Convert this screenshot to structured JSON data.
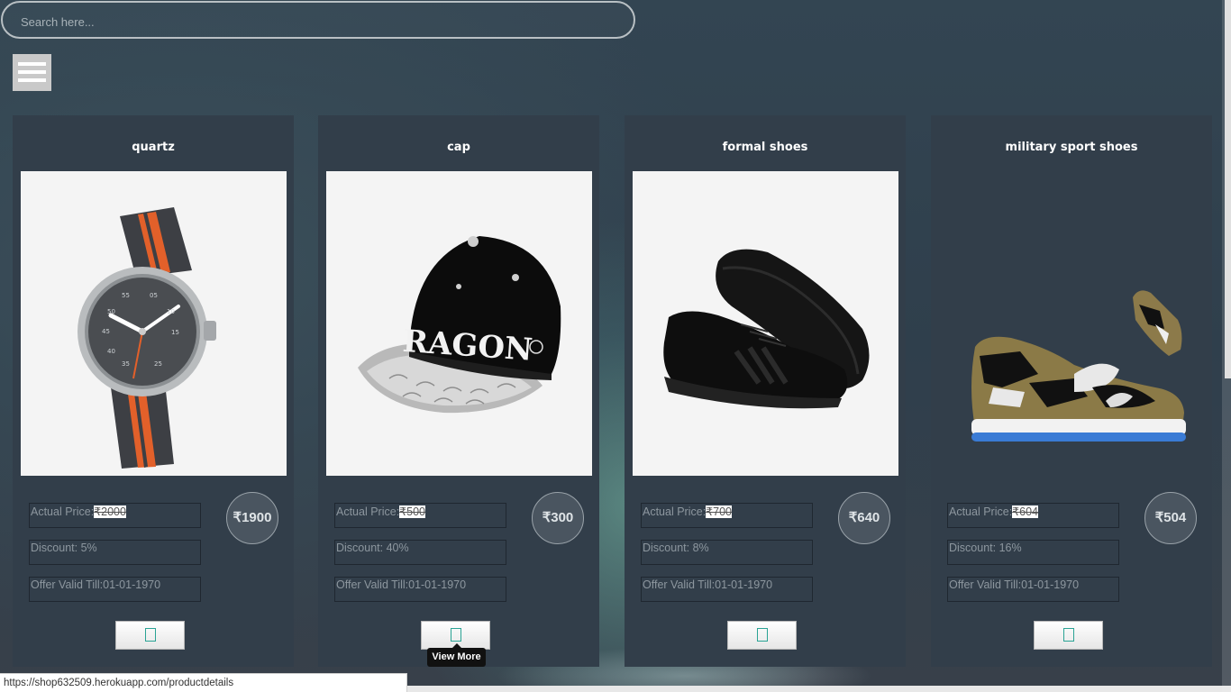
{
  "search": {
    "placeholder": "Search here...",
    "value": ""
  },
  "menu": {
    "icon": "hamburger-menu-icon"
  },
  "products": [
    {
      "title": "quartz",
      "image": "wristwatch-image",
      "actual_price_label": "Actual Price:",
      "actual_price": "₹2000",
      "discount": "Discount: 5%",
      "offer_valid": "Offer Valid Till:01-01-1970",
      "price": "₹1900"
    },
    {
      "title": "cap",
      "image": "snapback-cap-image",
      "actual_price_label": "Actual Price:",
      "actual_price": "₹500",
      "discount": "Discount: 40%",
      "offer_valid": "Offer Valid Till:01-01-1970",
      "price": "₹300"
    },
    {
      "title": "formal shoes",
      "image": "black-sneakers-image",
      "actual_price_label": "Actual Price:",
      "actual_price": "₹700",
      "discount": "Discount: 8%",
      "offer_valid": "Offer Valid Till:01-01-1970",
      "price": "₹640"
    },
    {
      "title": "military sport shoes",
      "image": "camo-sneakers-image",
      "actual_price_label": "Actual Price:",
      "actual_price": "₹604",
      "discount": "Discount: 16%",
      "offer_valid": "Offer Valid Till:01-01-1970",
      "price": "₹504"
    }
  ],
  "tooltip": {
    "text": "View More"
  },
  "status_bar": {
    "url": "https://shop632509.herokuapp.com/productdetails"
  },
  "colors": {
    "card_bg": "#323e4a",
    "accent_icon": "#2aa394"
  }
}
